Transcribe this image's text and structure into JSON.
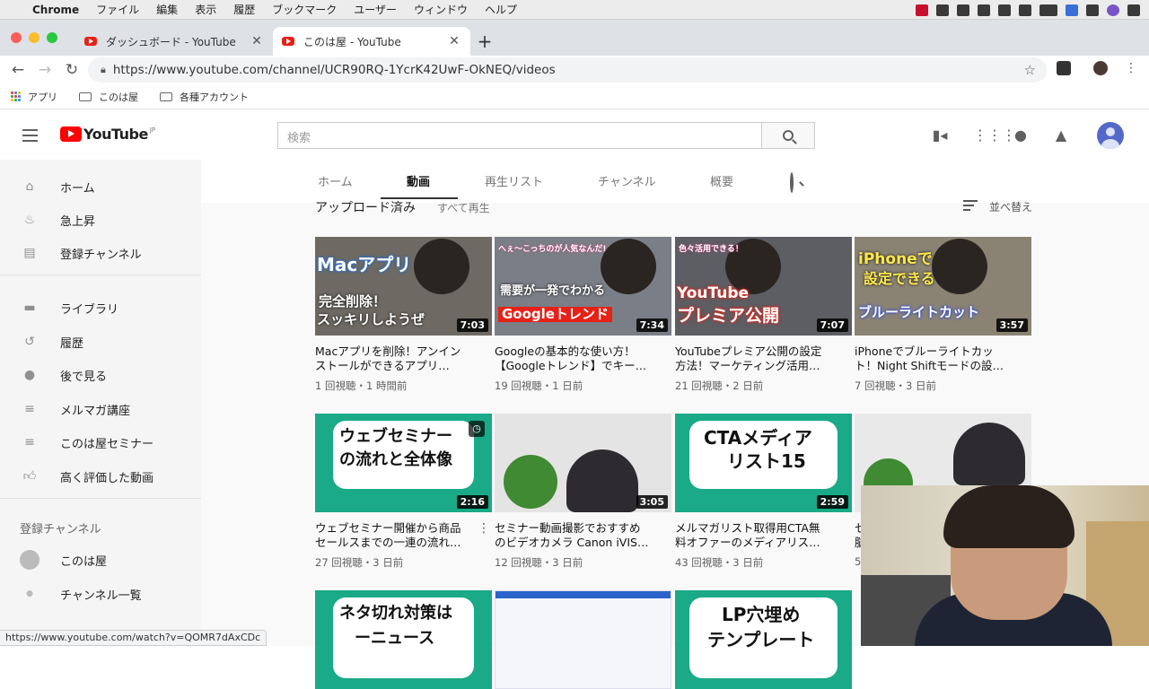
{
  "mac_menu": {
    "app": "Chrome",
    "items": [
      "ファイル",
      "編集",
      "表示",
      "履歴",
      "ブックマーク",
      "ユーザー",
      "ウィンドウ",
      "ヘルプ"
    ]
  },
  "tabs": [
    {
      "title": "ダッシュボード - YouTube",
      "active": false
    },
    {
      "title": "このは屋 - YouTube",
      "active": true
    }
  ],
  "omnibox": {
    "url": "https://www.youtube.com/channel/UCR90RQ-1YcrK42UwF-OkNEQ/videos"
  },
  "bookmarks": [
    {
      "label": "アプリ",
      "icon": "apps-grid-icon"
    },
    {
      "label": "このは屋",
      "icon": "folder-icon"
    },
    {
      "label": "各種アカウント",
      "icon": "folder-icon"
    }
  ],
  "youtube": {
    "logo_text": "YouTube",
    "logo_region": "JP",
    "search_placeholder": "検索"
  },
  "sidebar": {
    "items": [
      {
        "label": "ホーム",
        "icon": "home-icon"
      },
      {
        "label": "急上昇",
        "icon": "trending-icon"
      },
      {
        "label": "登録チャンネル",
        "icon": "subscriptions-icon"
      },
      {
        "label": "ライブラリ",
        "icon": "library-icon"
      },
      {
        "label": "履歴",
        "icon": "history-icon"
      },
      {
        "label": "後で見る",
        "icon": "watch-later-icon"
      },
      {
        "label": "メルマガ講座",
        "icon": "playlist-icon"
      },
      {
        "label": "このは屋セミナー",
        "icon": "playlist-icon"
      },
      {
        "label": "高く評価した動画",
        "icon": "thumbs-up-icon"
      }
    ],
    "subs_heading": "登録チャンネル",
    "subs": [
      {
        "label": "このは屋",
        "icon": "channel-avatar-icon"
      },
      {
        "label": "チャンネル一覧",
        "icon": "channel-list-icon"
      }
    ]
  },
  "channel_tabs": [
    {
      "label": "ホーム",
      "active": false
    },
    {
      "label": "動画",
      "active": true
    },
    {
      "label": "再生リスト",
      "active": false
    },
    {
      "label": "チャンネル",
      "active": false
    },
    {
      "label": "概要",
      "active": false
    }
  ],
  "section": {
    "title": "アップロード済み",
    "play_all": "すべて再生",
    "sort": "並べ替え"
  },
  "videos": [
    {
      "title1": "Macアプリを削除！アンイン",
      "title2": "ストールができるアプリ…",
      "meta": "1 回視聴・1 時間前",
      "duration": "7:03",
      "thumb_line1": "Macアプリ",
      "thumb_line2": "完全削除！",
      "thumb_line3": "スッキリしようぜ"
    },
    {
      "title1": "Googleの基本的な使い方！",
      "title2": "【Googleトレンド】でキー…",
      "meta": "19 回視聴・1 日前",
      "duration": "7:34",
      "thumb_line1": "へぇ〜こっちのが人気なんだ!",
      "thumb_line2": "需要が一発でわかる",
      "thumb_line3": "Googleトレンド"
    },
    {
      "title1": "YouTubeプレミア公開の設定",
      "title2": "方法！マーケティング活用…",
      "meta": "21 回視聴・2 日前",
      "duration": "7:07",
      "thumb_line1": "色々活用できる！",
      "thumb_line2": "YouTube",
      "thumb_line3": "プレミア公開"
    },
    {
      "title1": "iPhoneでブルーライトカッ",
      "title2": "ト！Night Shiftモードの設…",
      "meta": "7 回視聴・3 日前",
      "duration": "3:57",
      "thumb_line1": "iPhoneで",
      "thumb_line2": "設定できる",
      "thumb_line3": "ブルーライトカット"
    },
    {
      "title1": "ウェブセミナー開催から商品",
      "title2": "セールスまでの一連の流れ…",
      "meta": "27 回視聴・3 日前",
      "duration": "2:16",
      "thumb_line1": "ウェブセミナー",
      "thumb_line2": "の流れと全体像",
      "thumb_line3": ""
    },
    {
      "title1": "セミナー動画撮影でおすすめ",
      "title2": "のビデオカメラ Canon iVIS…",
      "meta": "12 回視聴・3 日前",
      "duration": "3:05",
      "thumb_line1": "",
      "thumb_line2": "",
      "thumb_line3": ""
    },
    {
      "title1": "メルマガリスト取得用CTA無",
      "title2": "料オファーのメディアリス…",
      "meta": "43 回視聴・3 日前",
      "duration": "2:59",
      "thumb_line1": "CTAメディア",
      "thumb_line2": "リスト15",
      "thumb_line3": ""
    },
    {
      "title1": "セ",
      "title2": "脳",
      "meta": "5",
      "duration": "",
      "thumb_line1": "",
      "thumb_line2": "",
      "thumb_line3": ""
    },
    {
      "title1": "",
      "title2": "",
      "meta": "",
      "duration": "",
      "thumb_line1": "ネタ切れ対策は",
      "thumb_line2": "ーニュース",
      "thumb_line3": ""
    },
    {
      "title1": "",
      "title2": "",
      "meta": "",
      "duration": "",
      "thumb_line1": "",
      "thumb_line2": "",
      "thumb_line3": ""
    },
    {
      "title1": "",
      "title2": "",
      "meta": "",
      "duration": "",
      "thumb_line1": "LP穴埋め",
      "thumb_line2": "テンプレート",
      "thumb_line3": ""
    }
  ],
  "status_url": "https://www.youtube.com/watch?v=QOMR7dAxCDc",
  "colors": {
    "yt_red": "#ff0000",
    "teal": "#1aaa87",
    "accent_blue": "#2b4bd8"
  }
}
